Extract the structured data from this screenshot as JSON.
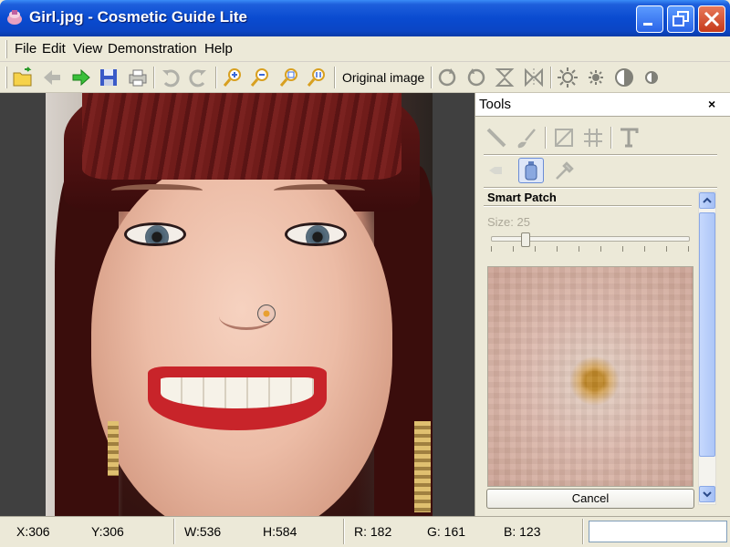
{
  "window": {
    "title": "Girl.jpg - Cosmetic Guide Lite"
  },
  "menu": {
    "items": [
      "File",
      "Edit",
      "View",
      "Demonstration",
      "Help"
    ]
  },
  "toolbar": {
    "buttons": [
      {
        "name": "open-icon"
      },
      {
        "name": "back-icon"
      },
      {
        "name": "forward-icon"
      },
      {
        "name": "save-icon"
      },
      {
        "name": "print-icon"
      },
      {
        "name": "undo-icon"
      },
      {
        "name": "redo-icon"
      },
      {
        "name": "zoom-in-icon"
      },
      {
        "name": "zoom-out-icon"
      },
      {
        "name": "zoom-fit-icon"
      },
      {
        "name": "zoom-actual-icon"
      },
      {
        "name": "rotate-cw-icon"
      },
      {
        "name": "rotate-ccw-icon"
      },
      {
        "name": "flip-vertical-icon"
      },
      {
        "name": "flip-horizontal-icon"
      },
      {
        "name": "brightness-up-icon"
      },
      {
        "name": "brightness-down-icon"
      },
      {
        "name": "contrast-up-icon"
      },
      {
        "name": "contrast-down-icon"
      }
    ],
    "original_image_label": "Original image"
  },
  "tools_panel": {
    "title": "Tools",
    "close_glyph": "×",
    "smart_patch_label": "Smart Patch",
    "size_label": "Size: 25",
    "size_value": 25,
    "cancel_label": "Cancel",
    "tool_icons": [
      "line-tool-icon",
      "brush-tool-icon",
      "crop-tool-icon",
      "grid-tool-icon",
      "text-tool-icon",
      "eraser-tool-icon",
      "bottle-tool-icon",
      "pipette-tool-icon"
    ]
  },
  "status": {
    "x": "X:306",
    "y": "Y:306",
    "w": "W:536",
    "h": "H:584",
    "r": "R: 182",
    "g": "G: 161",
    "b": "B: 123"
  },
  "colors": {
    "titlebar": "#0a4bd0",
    "close_button": "#c53a1b",
    "canvas_bg": "#404040",
    "panel_bg": "#ece9d8"
  }
}
